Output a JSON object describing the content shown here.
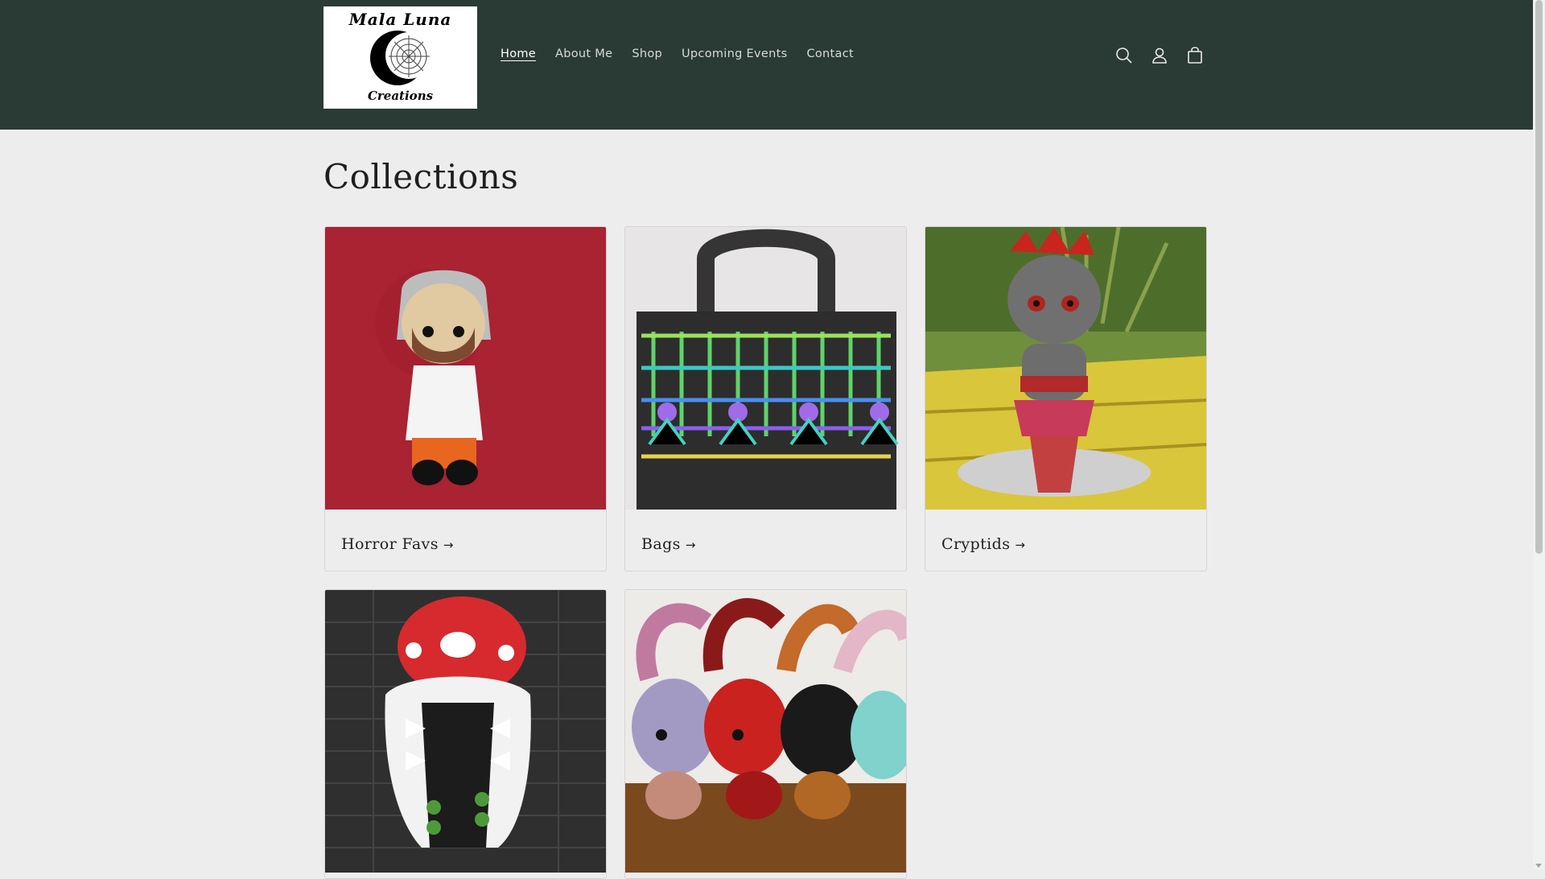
{
  "header": {
    "logo": {
      "line1": "Mala Luna",
      "line2": "Creations"
    },
    "nav": [
      {
        "label": "Home",
        "active": true
      },
      {
        "label": "About Me",
        "active": false
      },
      {
        "label": "Shop",
        "active": false
      },
      {
        "label": "Upcoming Events",
        "active": false
      },
      {
        "label": "Contact",
        "active": false
      }
    ],
    "icons": [
      "search-icon",
      "account-icon",
      "cart-icon"
    ]
  },
  "main": {
    "title": "Collections",
    "collections": [
      {
        "label": "Horror Favs",
        "arrow": "→",
        "image": "crochet-doll-horror"
      },
      {
        "label": "Bags",
        "arrow": "→",
        "image": "crochet-spider-bag"
      },
      {
        "label": "Cryptids",
        "arrow": "→",
        "image": "crochet-mermaid"
      },
      {
        "label": "",
        "arrow": "",
        "image": "crochet-piranha-hood"
      },
      {
        "label": "",
        "arrow": "",
        "image": "crochet-baphomet-plushies"
      }
    ]
  },
  "colors": {
    "header_bg": "#2a3a34",
    "page_bg": "#eeedee",
    "nav_text": "#d7dbd9"
  }
}
